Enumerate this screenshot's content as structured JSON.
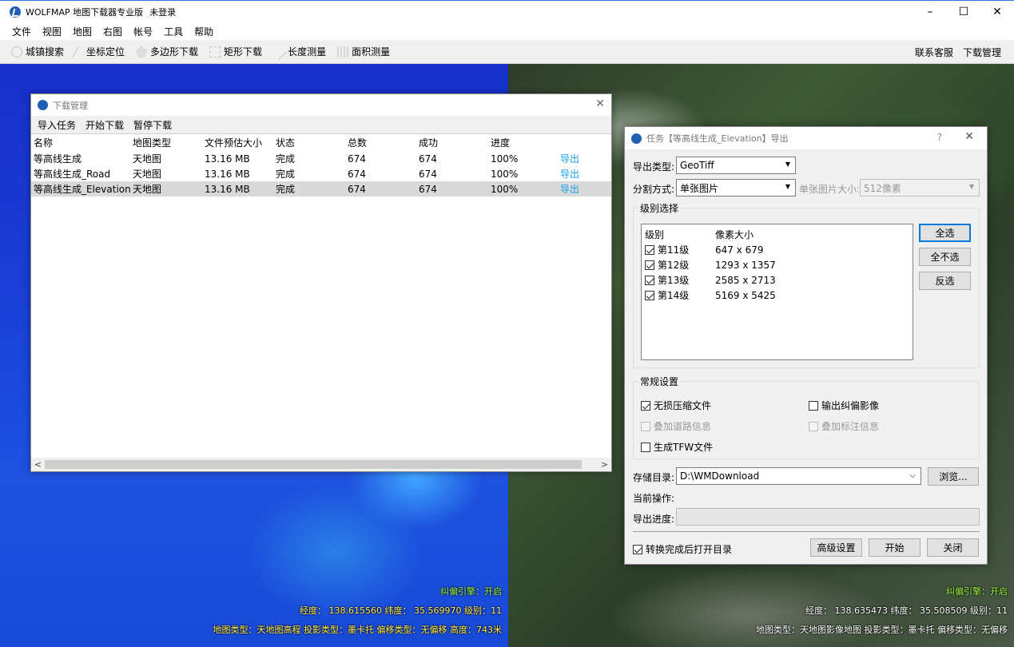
{
  "app": {
    "title": "WOLFMAP 地图下载器专业版",
    "login_status": "未登录",
    "min": "–",
    "max": "☐",
    "close": "✕"
  },
  "menu": [
    "文件",
    "视图",
    "地图",
    "右图",
    "帐号",
    "工具",
    "帮助"
  ],
  "toolbar": {
    "tools": [
      "城镇搜索",
      "坐标定位",
      "多边形下载",
      "矩形下载",
      "长度测量",
      "面积测量"
    ],
    "right": [
      "联系客服",
      "下载管理"
    ]
  },
  "map_left": {
    "correction": "纠偏引擎：开启",
    "coords": "经度： 138.615560 纬度： 35.569970 级别：11",
    "info": "地图类型：天地图高程  投影类型：墨卡托  偏移类型：无偏移  高度：743米"
  },
  "map_right": {
    "correction": "纠偏引擎：开启",
    "coords": "经度： 138.635473 纬度： 35.508509 级别：11",
    "info": "地图类型：天地图影像地图  投影类型：墨卡托  偏移类型：无偏移"
  },
  "download_manager": {
    "title": "下载管理",
    "close": "✕",
    "menu": [
      "导入任务",
      "开始下载",
      "暂停下载"
    ],
    "columns": [
      "名称",
      "地图类型",
      "文件预估大小",
      "状态",
      "总数",
      "成功",
      "进度",
      ""
    ],
    "rows": [
      [
        "等高线生成",
        "天地图",
        "13.16 MB",
        "完成",
        "674",
        "674",
        "100%",
        "导出"
      ],
      [
        "等高线生成_Road",
        "天地图",
        "13.16 MB",
        "完成",
        "674",
        "674",
        "100%",
        "导出"
      ],
      [
        "等高线生成_Elevation",
        "天地图",
        "13.16 MB",
        "完成",
        "674",
        "674",
        "100%",
        "导出"
      ]
    ],
    "selected_row": 2,
    "scroll_left": "<",
    "scroll_right": ">"
  },
  "export_dialog": {
    "title": "任务【等高线生成_Elevation】导出",
    "help": "?",
    "close": "✕",
    "export_type_label": "导出类型:",
    "export_type_value": "GeoTiff",
    "split_label": "分割方式:",
    "split_value": "单张图片",
    "tile_size_label": "单张图片大小:",
    "tile_size_value": "512像素",
    "level_group": "级别选择",
    "level_columns": [
      "级别",
      "像素大小"
    ],
    "levels": [
      {
        "level": "第11级",
        "size": "647 x 679",
        "checked": true
      },
      {
        "level": "第12级",
        "size": "1293 x 1357",
        "checked": true
      },
      {
        "level": "第13级",
        "size": "2585 x 2713",
        "checked": true
      },
      {
        "level": "第14级",
        "size": "5169 x 5425",
        "checked": true
      }
    ],
    "select_all": "全选",
    "select_none": "全不选",
    "invert": "反选",
    "general_group": "常规设置",
    "opt_lossless": "无损压缩文件",
    "opt_corrected": "输出纠偏影像",
    "opt_road": "叠加道路信息",
    "opt_label": "叠加标注信息",
    "opt_tfw": "生成TFW文件",
    "dir_label": "存储目录:",
    "dir_value": "D:\\WMDownload",
    "browse": "浏览...",
    "current_op_label": "当前操作:",
    "progress_label": "导出进度:",
    "progress_value": 0,
    "open_dir": "转换完成后打开目录",
    "advanced": "高级设置",
    "start": "开始",
    "close_btn": "关闭"
  }
}
